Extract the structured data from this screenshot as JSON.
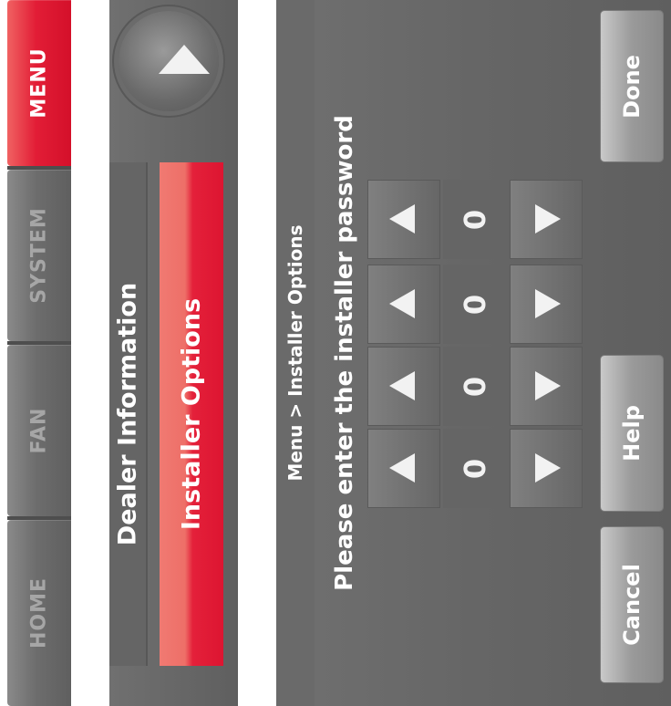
{
  "nav": {
    "tabs": [
      {
        "label": "HOME",
        "active": false
      },
      {
        "label": "FAN",
        "active": false
      },
      {
        "label": "SYSTEM",
        "active": false
      },
      {
        "label": "MENU",
        "active": true
      }
    ]
  },
  "menu": {
    "items": [
      {
        "label": "Dealer Information"
      },
      {
        "label": "Installer Options",
        "selected": true
      }
    ]
  },
  "password_screen": {
    "breadcrumb": "Menu > Installer Options",
    "prompt": "Please enter the installer password",
    "digits": [
      "0",
      "0",
      "0",
      "0"
    ],
    "buttons": {
      "cancel": "Cancel",
      "help": "Help",
      "done": "Done"
    }
  },
  "colors": {
    "accent": "#e21d36",
    "panel": "#666666",
    "text": "#ffffff"
  }
}
